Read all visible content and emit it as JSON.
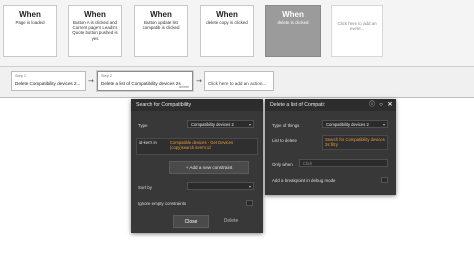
{
  "events": [
    {
      "when": "When",
      "desc": "Page is loaded"
    },
    {
      "when": "When",
      "desc": "Button A is clicked and Current page's Leads's Quote button pushed is yes"
    },
    {
      "when": "When",
      "desc": "Button update list compatib is clicked"
    },
    {
      "when": "When",
      "desc": "delete copy is clicked"
    },
    {
      "when": "When",
      "desc": "delete is clicked"
    },
    {
      "when": "",
      "desc": "Click here to add an event..."
    }
  ],
  "steps": [
    {
      "num": "Step 1",
      "text": "Delete Compatibility devices 2...",
      "del": ""
    },
    {
      "num": "Step 2",
      "text": "Delete a list of Compatibility devices 2s",
      "del": "delete"
    },
    {
      "num": "",
      "text": "Click here to add an action...",
      "del": ""
    }
  ],
  "search_panel": {
    "title": "Search for Compatibility",
    "type_label": "Type",
    "type_value": "Compatibility devices 2",
    "constraint_field": "id-ken't in",
    "constraint_value": "Compatible devices - Get Devices (copy)search item's id",
    "add_constraint": "Add a new constraint",
    "sort_by": "Sort by",
    "ignore_empty": "Ignore empty constraints",
    "close": "Close",
    "delete": "Delete"
  },
  "delete_panel": {
    "title": "Delete a list of Compati:",
    "type_label": "Type of things",
    "type_value": "Compatibility devices 2",
    "list_label": "List to delete",
    "list_value": "Search for Compatibility devices 2s:filt:y",
    "only_when": "Only when",
    "only_when_placeholder": "Click",
    "breakpoint": "Add a breakpoint in debug mode"
  },
  "icons": {
    "info": "info-icon",
    "comment": "comment-icon",
    "close": "close-icon",
    "plus": "plus-icon"
  },
  "colors": {
    "selected_event": "#9b9b9b",
    "panel_bg": "#383838",
    "expression_orange": "#e79a3c"
  }
}
